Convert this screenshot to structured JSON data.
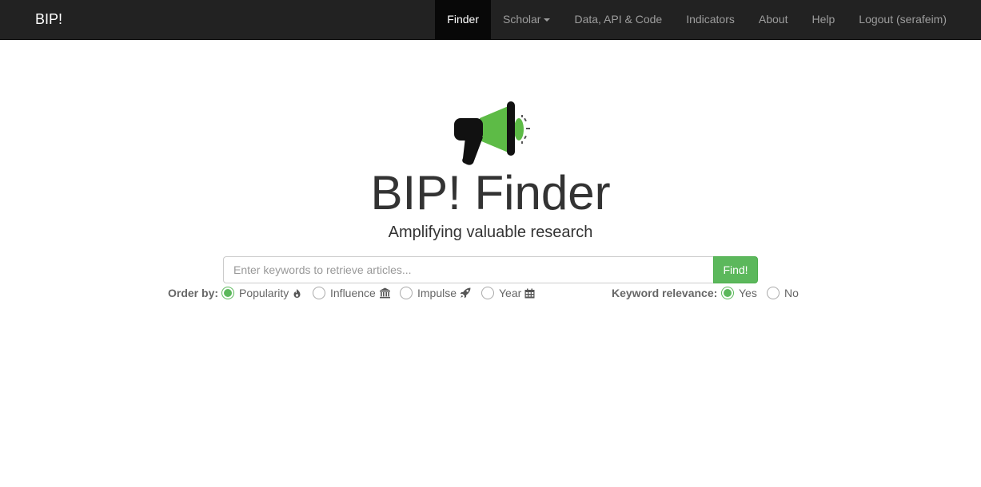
{
  "navbar": {
    "brand": "BIP!",
    "items": [
      {
        "label": "Finder",
        "active": true
      },
      {
        "label": "Scholar",
        "dropdown": true
      },
      {
        "label": "Data, API & Code"
      },
      {
        "label": "Indicators"
      },
      {
        "label": "About"
      },
      {
        "label": "Help"
      },
      {
        "label": "Logout (serafeim)"
      }
    ]
  },
  "hero": {
    "logo_icon": "megaphone-icon",
    "title": "BIP! Finder",
    "subtitle": "Amplifying valuable research"
  },
  "search": {
    "placeholder": "Enter keywords to retrieve articles...",
    "value": "",
    "button_label": "Find!"
  },
  "order_by": {
    "label": "Order by:",
    "options": [
      {
        "label": "Popularity",
        "icon": "fire-icon",
        "selected": true
      },
      {
        "label": "Influence",
        "icon": "bank-icon",
        "selected": false
      },
      {
        "label": "Impulse",
        "icon": "rocket-icon",
        "selected": false
      },
      {
        "label": "Year",
        "icon": "calendar-icon",
        "selected": false
      }
    ]
  },
  "keyword_relevance": {
    "label": "Keyword relevance:",
    "options": [
      {
        "label": "Yes",
        "selected": true
      },
      {
        "label": "No",
        "selected": false
      }
    ]
  },
  "colors": {
    "navbar_bg": "#222222",
    "accent": "#5cb85c",
    "logo_green": "#5dbb46"
  }
}
